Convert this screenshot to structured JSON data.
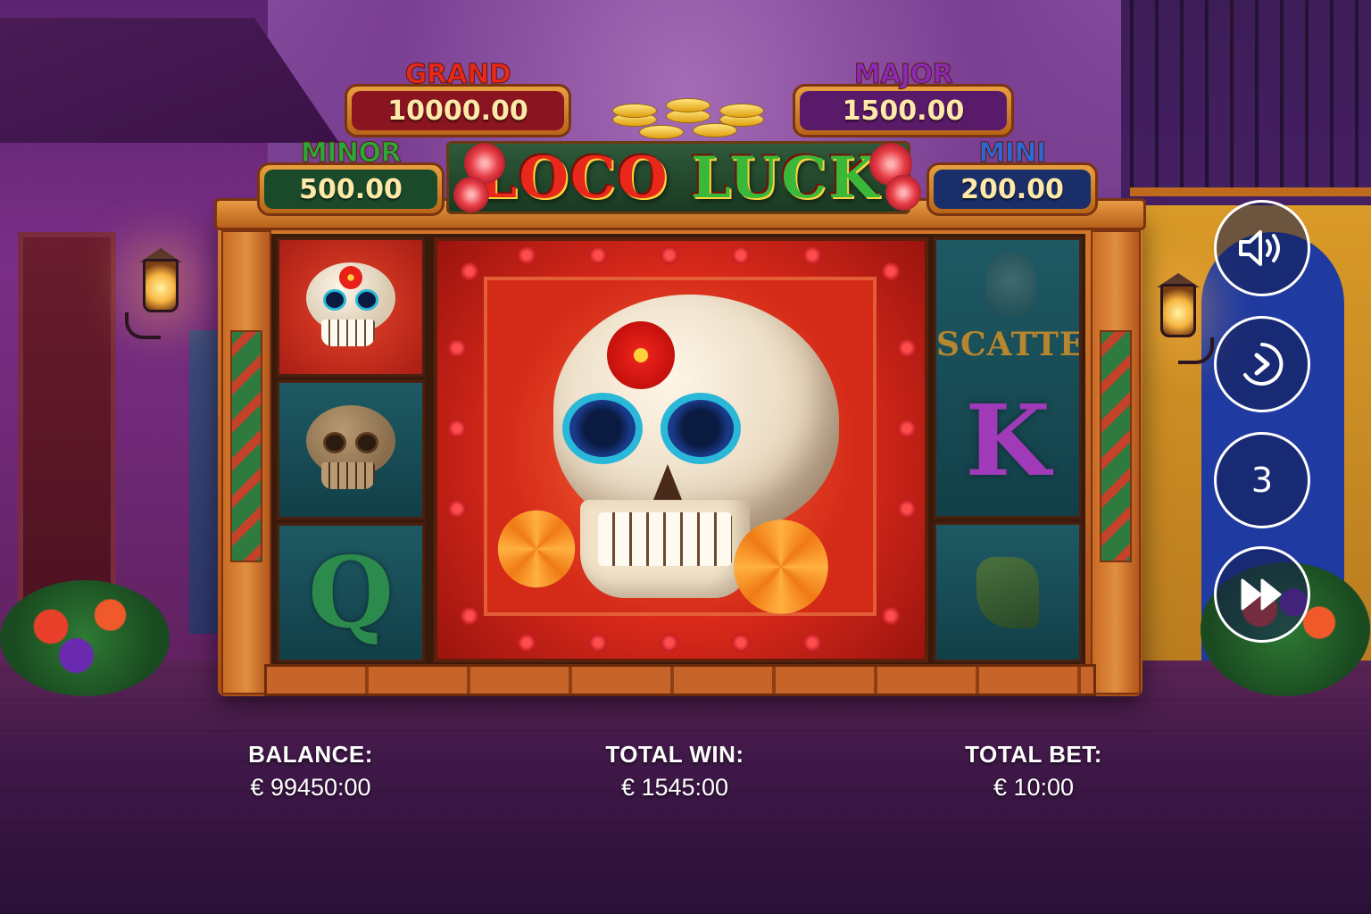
{
  "game": {
    "title": "LOCO LUCK",
    "title_parts": [
      "LOCO",
      "LUCK"
    ]
  },
  "jackpots": {
    "grand": {
      "label": "GRAND",
      "value": "10000.00",
      "label_color": "#e8281a",
      "panel_color": "#8a1420"
    },
    "major": {
      "label": "MAJOR",
      "value": "1500.00",
      "label_color": "#8a2ab8",
      "panel_color": "#5a1a6a"
    },
    "minor": {
      "label": "MINOR",
      "value": "500.00",
      "label_color": "#2ca83a",
      "panel_color": "#1a4a2a"
    },
    "mini": {
      "label": "MINI",
      "value": "200.00",
      "label_color": "#2a6ad8",
      "panel_color": "#1a2e6a"
    }
  },
  "reels": {
    "left": [
      {
        "symbol": "sugar-skull",
        "highlighted": true
      },
      {
        "symbol": "skull-dim",
        "highlighted": false
      },
      {
        "symbol": "letter",
        "text": "Q",
        "highlighted": false
      }
    ],
    "center": {
      "symbol": "big-sugar-skull",
      "highlighted": true
    },
    "right": [
      {
        "symbol": "scatter",
        "text": "SCATTER",
        "highlighted": false
      },
      {
        "symbol": "letter",
        "text": "K",
        "highlighted": false
      },
      {
        "symbol": "boot",
        "highlighted": false
      }
    ]
  },
  "controls": {
    "sound_icon": "speaker-icon",
    "autoplay_icon": "autoplay-icon",
    "speed_value": "3",
    "turbo_icon": "fast-forward-icon"
  },
  "footer": {
    "balance_label": "BALANCE:",
    "balance_value": "€ 99450:00",
    "win_label": "TOTAL WIN:",
    "win_value": "€ 1545:00",
    "bet_label": "TOTAL BET:",
    "bet_value": "€ 10:00"
  },
  "colors": {
    "accent": "#e8a040",
    "sky": "#8d55a6",
    "reel_teal": "#1e5a64",
    "highlight_red": "#d8281a"
  }
}
